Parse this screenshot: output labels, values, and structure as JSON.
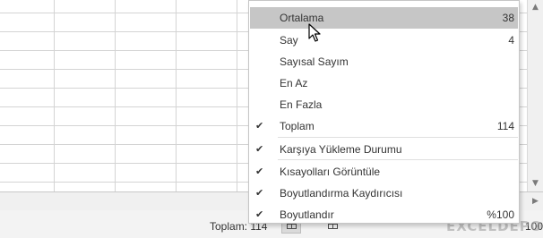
{
  "status_bar": {
    "sum_text": "Toplam: 114",
    "zoom_text": "100"
  },
  "context_menu": {
    "items": [
      {
        "label": "Ortalama",
        "value": "38",
        "checked": false,
        "highlighted": true
      },
      {
        "label": "Say",
        "value": "4",
        "checked": false,
        "highlighted": false
      },
      {
        "label": "Sayısal Sayım",
        "value": "",
        "checked": false,
        "highlighted": false
      },
      {
        "label": "En Az",
        "value": "",
        "checked": false,
        "highlighted": false
      },
      {
        "label": "En Fazla",
        "value": "",
        "checked": false,
        "highlighted": false
      },
      {
        "label": "Toplam",
        "value": "114",
        "checked": true,
        "highlighted": false
      },
      {
        "label": "Karşıya Yükleme Durumu",
        "value": "",
        "checked": true,
        "highlighted": false
      },
      {
        "label": "Kısayolları Görüntüle",
        "value": "",
        "checked": true,
        "highlighted": false
      },
      {
        "label": "Boyutlandırma Kaydırıcısı",
        "value": "",
        "checked": true,
        "highlighted": false
      },
      {
        "label": "Boyutlandır",
        "value": "%100",
        "checked": true,
        "highlighted": false
      }
    ],
    "check_glyph": "✔"
  },
  "watermark": {
    "text": "EXCELDEPO"
  },
  "icons": {
    "scroll_up": "▲",
    "scroll_down": "▼",
    "scroll_right": "▶",
    "cursor": "pointer-arrow-icon"
  },
  "colors": {
    "menu_highlight": "#c6c6c6",
    "status_bar_bg": "#f3f3f3",
    "grid_line": "#d4d4d4"
  }
}
